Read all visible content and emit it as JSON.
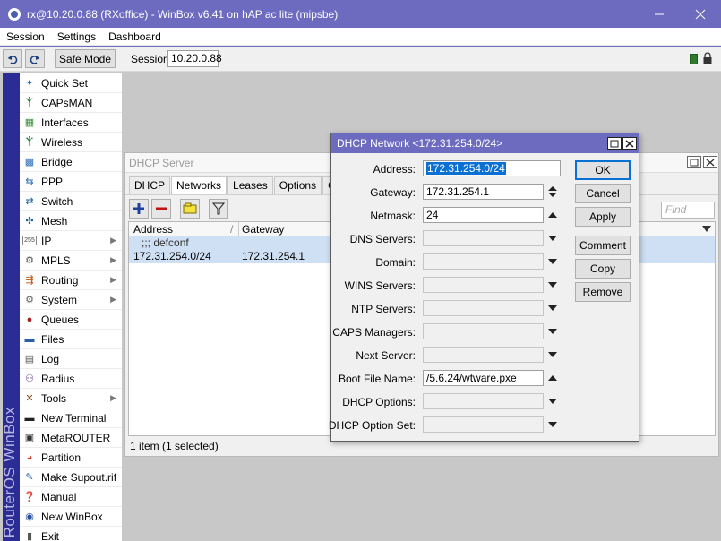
{
  "window": {
    "title": "rx@10.20.0.88 (RXoffice) - WinBox v6.41 on hAP ac lite (mipsbe)"
  },
  "menu": [
    "Session",
    "Settings",
    "Dashboard"
  ],
  "toolbar": {
    "safe_mode": "Safe Mode",
    "session_label": "Session:",
    "session_value": "10.20.0.88"
  },
  "sidebar": {
    "brand": "RouterOS WinBox",
    "items": [
      {
        "label": "Quick Set",
        "icon": "wand-icon"
      },
      {
        "label": "CAPsMAN",
        "icon": "antenna-icon"
      },
      {
        "label": "Interfaces",
        "icon": "interfaces-icon"
      },
      {
        "label": "Wireless",
        "icon": "wireless-icon"
      },
      {
        "label": "Bridge",
        "icon": "bridge-icon"
      },
      {
        "label": "PPP",
        "icon": "ppp-icon"
      },
      {
        "label": "Switch",
        "icon": "switch-icon"
      },
      {
        "label": "Mesh",
        "icon": "mesh-icon"
      },
      {
        "label": "IP",
        "icon": "ip-icon",
        "submenu": true
      },
      {
        "label": "MPLS",
        "icon": "mpls-icon",
        "submenu": true
      },
      {
        "label": "Routing",
        "icon": "routing-icon",
        "submenu": true
      },
      {
        "label": "System",
        "icon": "gear-icon",
        "submenu": true
      },
      {
        "label": "Queues",
        "icon": "queues-icon"
      },
      {
        "label": "Files",
        "icon": "folder-icon"
      },
      {
        "label": "Log",
        "icon": "log-icon"
      },
      {
        "label": "Radius",
        "icon": "radius-icon"
      },
      {
        "label": "Tools",
        "icon": "tools-icon",
        "submenu": true
      },
      {
        "label": "New Terminal",
        "icon": "terminal-icon"
      },
      {
        "label": "MetaROUTER",
        "icon": "metarouter-icon"
      },
      {
        "label": "Partition",
        "icon": "partition-icon"
      },
      {
        "label": "Make Supout.rif",
        "icon": "supout-icon"
      },
      {
        "label": "Manual",
        "icon": "manual-icon"
      },
      {
        "label": "New WinBox",
        "icon": "winbox-icon"
      },
      {
        "label": "Exit",
        "icon": "exit-icon"
      }
    ]
  },
  "dhcp_server": {
    "title": "DHCP Server",
    "tabs": [
      "DHCP",
      "Networks",
      "Leases",
      "Options",
      "Option"
    ],
    "active_tab": "Networks",
    "find_placeholder": "Find",
    "columns": [
      "Address",
      "Gateway"
    ],
    "sort_indicator": "/",
    "rows": [
      {
        "comment": ";;; defconf"
      },
      {
        "address": "172.31.254.0/24",
        "gateway": "172.31.254.1"
      }
    ],
    "status": "1 item (1 selected)"
  },
  "dialog": {
    "title": "DHCP Network <172.31.254.0/24>",
    "fields": [
      {
        "label": "Address:",
        "value": "172.31.254.0/24"
      },
      {
        "label": "Gateway:",
        "value": "172.31.254.1"
      },
      {
        "label": "Netmask:",
        "value": "24"
      },
      {
        "label": "DNS Servers:",
        "value": ""
      },
      {
        "label": "Domain:",
        "value": ""
      },
      {
        "label": "WINS Servers:",
        "value": ""
      },
      {
        "label": "NTP Servers:",
        "value": ""
      },
      {
        "label": "CAPS Managers:",
        "value": ""
      },
      {
        "label": "Next Server:",
        "value": ""
      },
      {
        "label": "Boot File Name:",
        "value": "/5.6.24/wtware.pxe"
      },
      {
        "label": "DHCP Options:",
        "value": ""
      },
      {
        "label": "DHCP Option Set:",
        "value": ""
      }
    ],
    "buttons": [
      "OK",
      "Cancel",
      "Apply",
      "Comment",
      "Copy",
      "Remove"
    ]
  },
  "colors": {
    "titlebar": "#6c6bbf",
    "selection": "#0a70d4",
    "row_selected": "#cfe0f4",
    "brand_bar": "#2c2c95"
  }
}
